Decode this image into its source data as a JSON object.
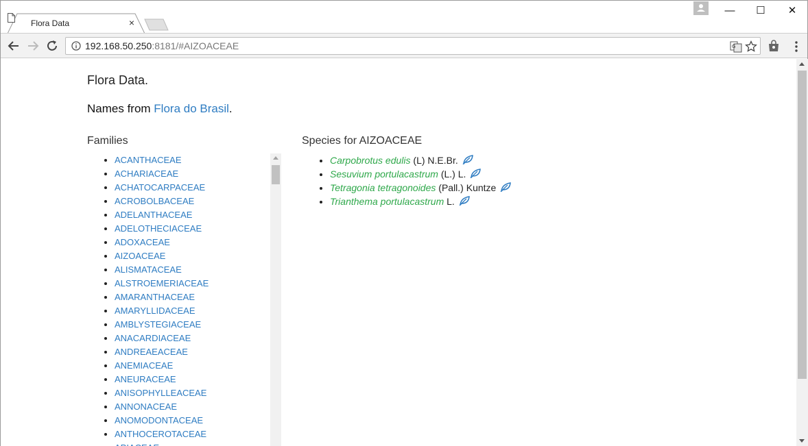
{
  "browser": {
    "tab_title": "Flora Data",
    "tab_close": "×",
    "url_host": "192.168.50.250",
    "url_rest": ":8181/#AIZOACEAE",
    "icons": [
      "page-icon",
      "back-icon",
      "forward-icon",
      "reload-icon",
      "info-icon",
      "translate-icon",
      "star-icon",
      "extension-icon",
      "menu-icon",
      "profile-icon"
    ],
    "window_controls": {
      "minimize": "—",
      "maximize": "☐",
      "close": "✕"
    }
  },
  "page": {
    "title": "Flora Data.",
    "subtitle_prefix": "Names from ",
    "subtitle_link": "Flora do Brasil",
    "subtitle_suffix": ".",
    "families_heading": "Families",
    "families": [
      "ACANTHACEAE",
      "ACHARIACEAE",
      "ACHATOCARPACEAE",
      "ACROBOLBACEAE",
      "ADELANTHACEAE",
      "ADELOTHECIACEAE",
      "ADOXACEAE",
      "AIZOACEAE",
      "ALISMATACEAE",
      "ALSTROEMERIACEAE",
      "AMARANTHACEAE",
      "AMARYLLIDACEAE",
      "AMBLYSTEGIACEAE",
      "ANACARDIACEAE",
      "ANDREAEACEAE",
      "ANEMIACEAE",
      "ANEURACEAE",
      "ANISOPHYLLEACEAE",
      "ANNONACEAE",
      "ANOMODONTACEAE",
      "ANTHOCEROTACEAE",
      "APIACEAE"
    ],
    "species_heading": "Species for AIZOACEAE",
    "species": [
      {
        "name": "Carpobrotus edulis",
        "author": " (L) N.E.Br."
      },
      {
        "name": "Sesuvium portulacastrum",
        "author": " (L.) L."
      },
      {
        "name": "Tetragonia tetragonoides",
        "author": " (Pall.) Kuntze"
      },
      {
        "name": "Trianthema portulacastrum",
        "author": " L."
      }
    ]
  },
  "colors": {
    "link": "#2e7cc2",
    "species_link": "#2ea84a",
    "leaf_icon": "#2e7cc2"
  }
}
